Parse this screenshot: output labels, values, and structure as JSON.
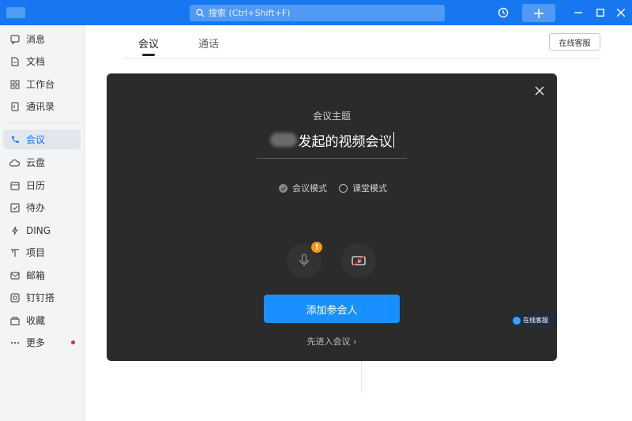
{
  "titlebar": {
    "search_placeholder": "搜索 (Ctrl+Shift+F)"
  },
  "sidebar": {
    "items": [
      {
        "label": "消息",
        "icon": "chat-icon"
      },
      {
        "label": "文档",
        "icon": "document-icon"
      },
      {
        "label": "工作台",
        "icon": "grid-icon"
      },
      {
        "label": "通讯录",
        "icon": "contacts-icon"
      },
      {
        "label": "会议",
        "icon": "phone-icon",
        "active": true
      },
      {
        "label": "云盘",
        "icon": "cloud-icon"
      },
      {
        "label": "日历",
        "icon": "calendar-icon"
      },
      {
        "label": "待办",
        "icon": "checkbox-icon"
      },
      {
        "label": "DING",
        "icon": "lightning-icon"
      },
      {
        "label": "项目",
        "icon": "project-icon"
      },
      {
        "label": "邮箱",
        "icon": "mail-icon"
      },
      {
        "label": "钉钉搭",
        "icon": "build-icon"
      },
      {
        "label": "收藏",
        "icon": "bookmark-icon"
      },
      {
        "label": "更多",
        "icon": "more-icon",
        "badge": "red-dot"
      }
    ]
  },
  "main": {
    "tabs": [
      {
        "label": "会议",
        "active": true
      },
      {
        "label": "通话",
        "active": false
      }
    ],
    "service_button": "在线客服"
  },
  "modal": {
    "topic_label": "会议主题",
    "topic_value": "发起的视频会议",
    "modes": [
      {
        "label": "会议模式",
        "checked": true
      },
      {
        "label": "课堂模式",
        "checked": false
      }
    ],
    "warning_badge": "!",
    "add_participants": "添加参会人",
    "enter_first": "先进入会议 ›"
  },
  "floating": {
    "chat_label": "在线客服"
  },
  "colors": {
    "brand_blue": "#1677f0",
    "modal_bg": "#2b2b2b",
    "primary_button": "#1890ff",
    "warning": "#fa9a14"
  }
}
